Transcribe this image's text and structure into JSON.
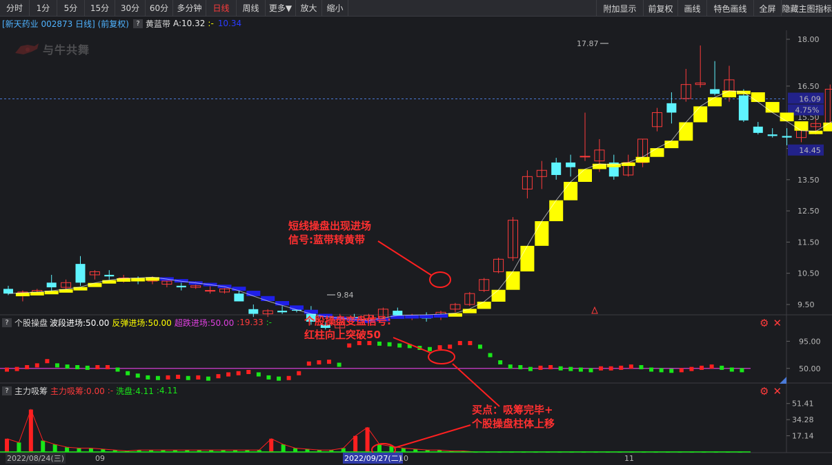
{
  "toolbar": {
    "items": [
      "分时",
      "1分",
      "5分",
      "15分",
      "30分",
      "60分",
      "多分钟",
      "日线",
      "周线",
      "更多▼",
      "放大",
      "缩小"
    ],
    "right_items": [
      "附加显示",
      "前复权",
      "画线",
      "特色画线",
      "全屏",
      "隐藏主图指标"
    ],
    "active": "日线"
  },
  "info": {
    "title": "[新天药业 002873 日线] (前复权)",
    "q": "?",
    "indicator": "黄蓝带",
    "a_value": "A:10.32",
    "sep": ":-",
    "b_value": "10.34"
  },
  "price_axis": {
    "ticks": [
      "18.00",
      "16.50",
      "15.50",
      "14.50",
      "13.50",
      "12.50",
      "11.50",
      "10.50",
      "9.50"
    ],
    "current_price": "16.09",
    "current_pct": "4.75%",
    "cursor_price": "14.45",
    "high_label": "17.87",
    "low_label": "9.84"
  },
  "panel2": {
    "q": "?",
    "name": "个股操盘",
    "a": "波段进场:50.00",
    "b": "反弹进场:50.00",
    "c": "超跌进场:50.00",
    "d": ":19.33",
    "e": ":-",
    "ticks": [
      "95.00",
      "50.00"
    ]
  },
  "panel3": {
    "q": "?",
    "name": "主力吸筹",
    "a": "主力吸筹:0.00",
    "b": ":-",
    "c": "洗盘:4.11",
    "d": ":4.11",
    "ticks": [
      "51.41",
      "34.28",
      "17.14"
    ]
  },
  "dates": {
    "d1": "2022/08/24(三)",
    "m1": "09",
    "d2": "2022/09/27(二)",
    "m2": "10",
    "m3": "11"
  },
  "annotations": {
    "a1_line1": "短线操盘出现进场",
    "a1_line2": "信号:蓝带转黄带",
    "a2_line1": "个股操盘变盘信号:",
    "a2_line2": "红柱向上突破50",
    "a3_line1": "买点：吸筹完毕+",
    "a3_line2": "个股操盘柱体上移"
  },
  "watermark": "与牛共舞",
  "colors": {
    "up": "#ff3b3b",
    "down": "#5ff4ff",
    "band_blue": "#1f1fe8",
    "band_yellow": "#ffff00",
    "vol_green": "#19e619",
    "annotation": "#ff2020",
    "pink": "#d13fd1"
  },
  "chart_data": [
    {
      "type": "candlestick",
      "title": "新天药业 002873 日线",
      "ylim": [
        9.5,
        18.0
      ],
      "candles": [
        [
          10.0,
          10.1,
          9.8,
          9.85
        ],
        [
          9.8,
          9.95,
          9.6,
          9.9
        ],
        [
          9.85,
          10.0,
          9.8,
          9.95
        ],
        [
          10.2,
          10.45,
          9.9,
          10.05
        ],
        [
          10.05,
          10.3,
          9.95,
          10.2
        ],
        [
          10.8,
          11.05,
          10.1,
          10.2
        ],
        [
          10.45,
          10.6,
          10.3,
          10.55
        ],
        [
          10.45,
          10.6,
          10.3,
          10.4
        ],
        [
          10.3,
          10.45,
          10.2,
          10.35
        ],
        [
          10.3,
          10.4,
          10.15,
          10.25
        ],
        [
          10.25,
          10.4,
          10.15,
          10.32
        ],
        [
          10.15,
          10.3,
          10.05,
          10.25
        ],
        [
          10.1,
          10.2,
          9.95,
          10.05
        ],
        [
          10.05,
          10.25,
          10.0,
          10.1
        ],
        [
          9.95,
          10.1,
          9.85,
          9.95
        ],
        [
          9.9,
          10.1,
          9.85,
          10.0
        ],
        [
          9.85,
          10.0,
          9.6,
          9.6
        ],
        [
          9.35,
          9.5,
          9.1,
          9.2
        ],
        [
          9.2,
          9.35,
          9.1,
          9.3
        ],
        [
          9.3,
          9.45,
          9.2,
          9.25
        ],
        [
          9.35,
          9.45,
          9.25,
          9.3
        ],
        [
          9.3,
          9.45,
          8.85,
          8.95
        ],
        [
          8.85,
          8.95,
          8.7,
          8.75
        ],
        [
          8.75,
          9.2,
          8.7,
          9.1
        ],
        [
          9.1,
          9.2,
          8.95,
          9.0
        ],
        [
          9.05,
          9.2,
          8.95,
          9.15
        ],
        [
          9.05,
          9.4,
          9.0,
          9.35
        ],
        [
          9.3,
          9.4,
          9.1,
          9.15
        ],
        [
          9.1,
          9.2,
          9.0,
          9.15
        ],
        [
          9.1,
          9.25,
          8.95,
          9.05
        ],
        [
          9.1,
          9.3,
          9.0,
          9.25
        ],
        [
          9.35,
          9.55,
          9.25,
          9.5
        ],
        [
          9.5,
          9.9,
          9.45,
          9.85
        ],
        [
          9.95,
          10.35,
          9.9,
          10.3
        ],
        [
          10.55,
          11.0,
          10.5,
          10.95
        ],
        [
          11.0,
          12.3,
          10.9,
          12.2
        ],
        [
          13.2,
          13.8,
          12.9,
          13.6
        ],
        [
          13.6,
          14.1,
          13.2,
          13.8
        ],
        [
          14.05,
          14.2,
          13.5,
          13.65
        ],
        [
          14.05,
          14.3,
          13.6,
          13.9
        ],
        [
          14.25,
          15.65,
          14.1,
          14.25
        ],
        [
          14.1,
          14.8,
          13.75,
          14.45
        ],
        [
          14.05,
          14.3,
          13.5,
          13.6
        ],
        [
          13.65,
          14.3,
          13.6,
          14.05
        ],
        [
          14.05,
          14.8,
          13.9,
          14.8
        ],
        [
          15.2,
          15.8,
          15.05,
          15.65
        ],
        [
          15.95,
          16.3,
          15.3,
          15.65
        ],
        [
          16.1,
          17.05,
          16.0,
          16.55
        ],
        [
          16.55,
          17.8,
          16.45,
          16.6
        ],
        [
          16.4,
          17.3,
          16.2,
          16.25
        ],
        [
          16.35,
          17.15,
          16.0,
          16.7
        ],
        [
          16.2,
          16.4,
          15.35,
          15.4
        ],
        [
          15.2,
          15.35,
          14.95,
          15.0
        ],
        [
          14.95,
          15.15,
          14.85,
          14.9
        ],
        [
          14.9,
          15.15,
          14.6,
          14.85
        ],
        [
          14.85,
          15.3,
          14.7,
          15.2
        ],
        [
          15.2,
          15.45,
          14.95,
          15.3
        ],
        [
          15.3,
          16.55,
          15.25,
          16.4
        ],
        [
          16.4,
          16.6,
          15.8,
          16.05
        ],
        [
          16.05,
          16.45,
          15.75,
          15.8
        ],
        [
          15.8,
          16.35,
          15.45,
          16.09
        ]
      ]
    },
    {
      "type": "bar",
      "title": "个股操盘",
      "ylim": [
        20,
        100
      ],
      "values": [
        48,
        49,
        52,
        55,
        62,
        55,
        53,
        52,
        51,
        52,
        52,
        48,
        42,
        38,
        35,
        34,
        35,
        36,
        34,
        35,
        33,
        37,
        40,
        42,
        44,
        40,
        35,
        33,
        34,
        42,
        58,
        60,
        61,
        56,
        88,
        92,
        92,
        91,
        90,
        88,
        87,
        84,
        82,
        85,
        86,
        92,
        92,
        86,
        72,
        60,
        53,
        52,
        49,
        51,
        52,
        50,
        49,
        48,
        47,
        50,
        50,
        51,
        53,
        52,
        48,
        47,
        46,
        47,
        49,
        51,
        53,
        51,
        48,
        47
      ]
    },
    {
      "type": "bar",
      "title": "主力吸筹",
      "ylim": [
        0,
        60
      ],
      "values": [
        14,
        10,
        45,
        12,
        8,
        5,
        4,
        4,
        3,
        2,
        1,
        2,
        2,
        2,
        2,
        2,
        2,
        2,
        2,
        2,
        2,
        2,
        14,
        8,
        4,
        3,
        2,
        2,
        4,
        17,
        26,
        8,
        6,
        4,
        3,
        2,
        2,
        1,
        1,
        0,
        0,
        0,
        0,
        0,
        0,
        0,
        0,
        0,
        0,
        0,
        0,
        0,
        0,
        0,
        0,
        0,
        0,
        0,
        0,
        0,
        0,
        0
      ]
    }
  ]
}
